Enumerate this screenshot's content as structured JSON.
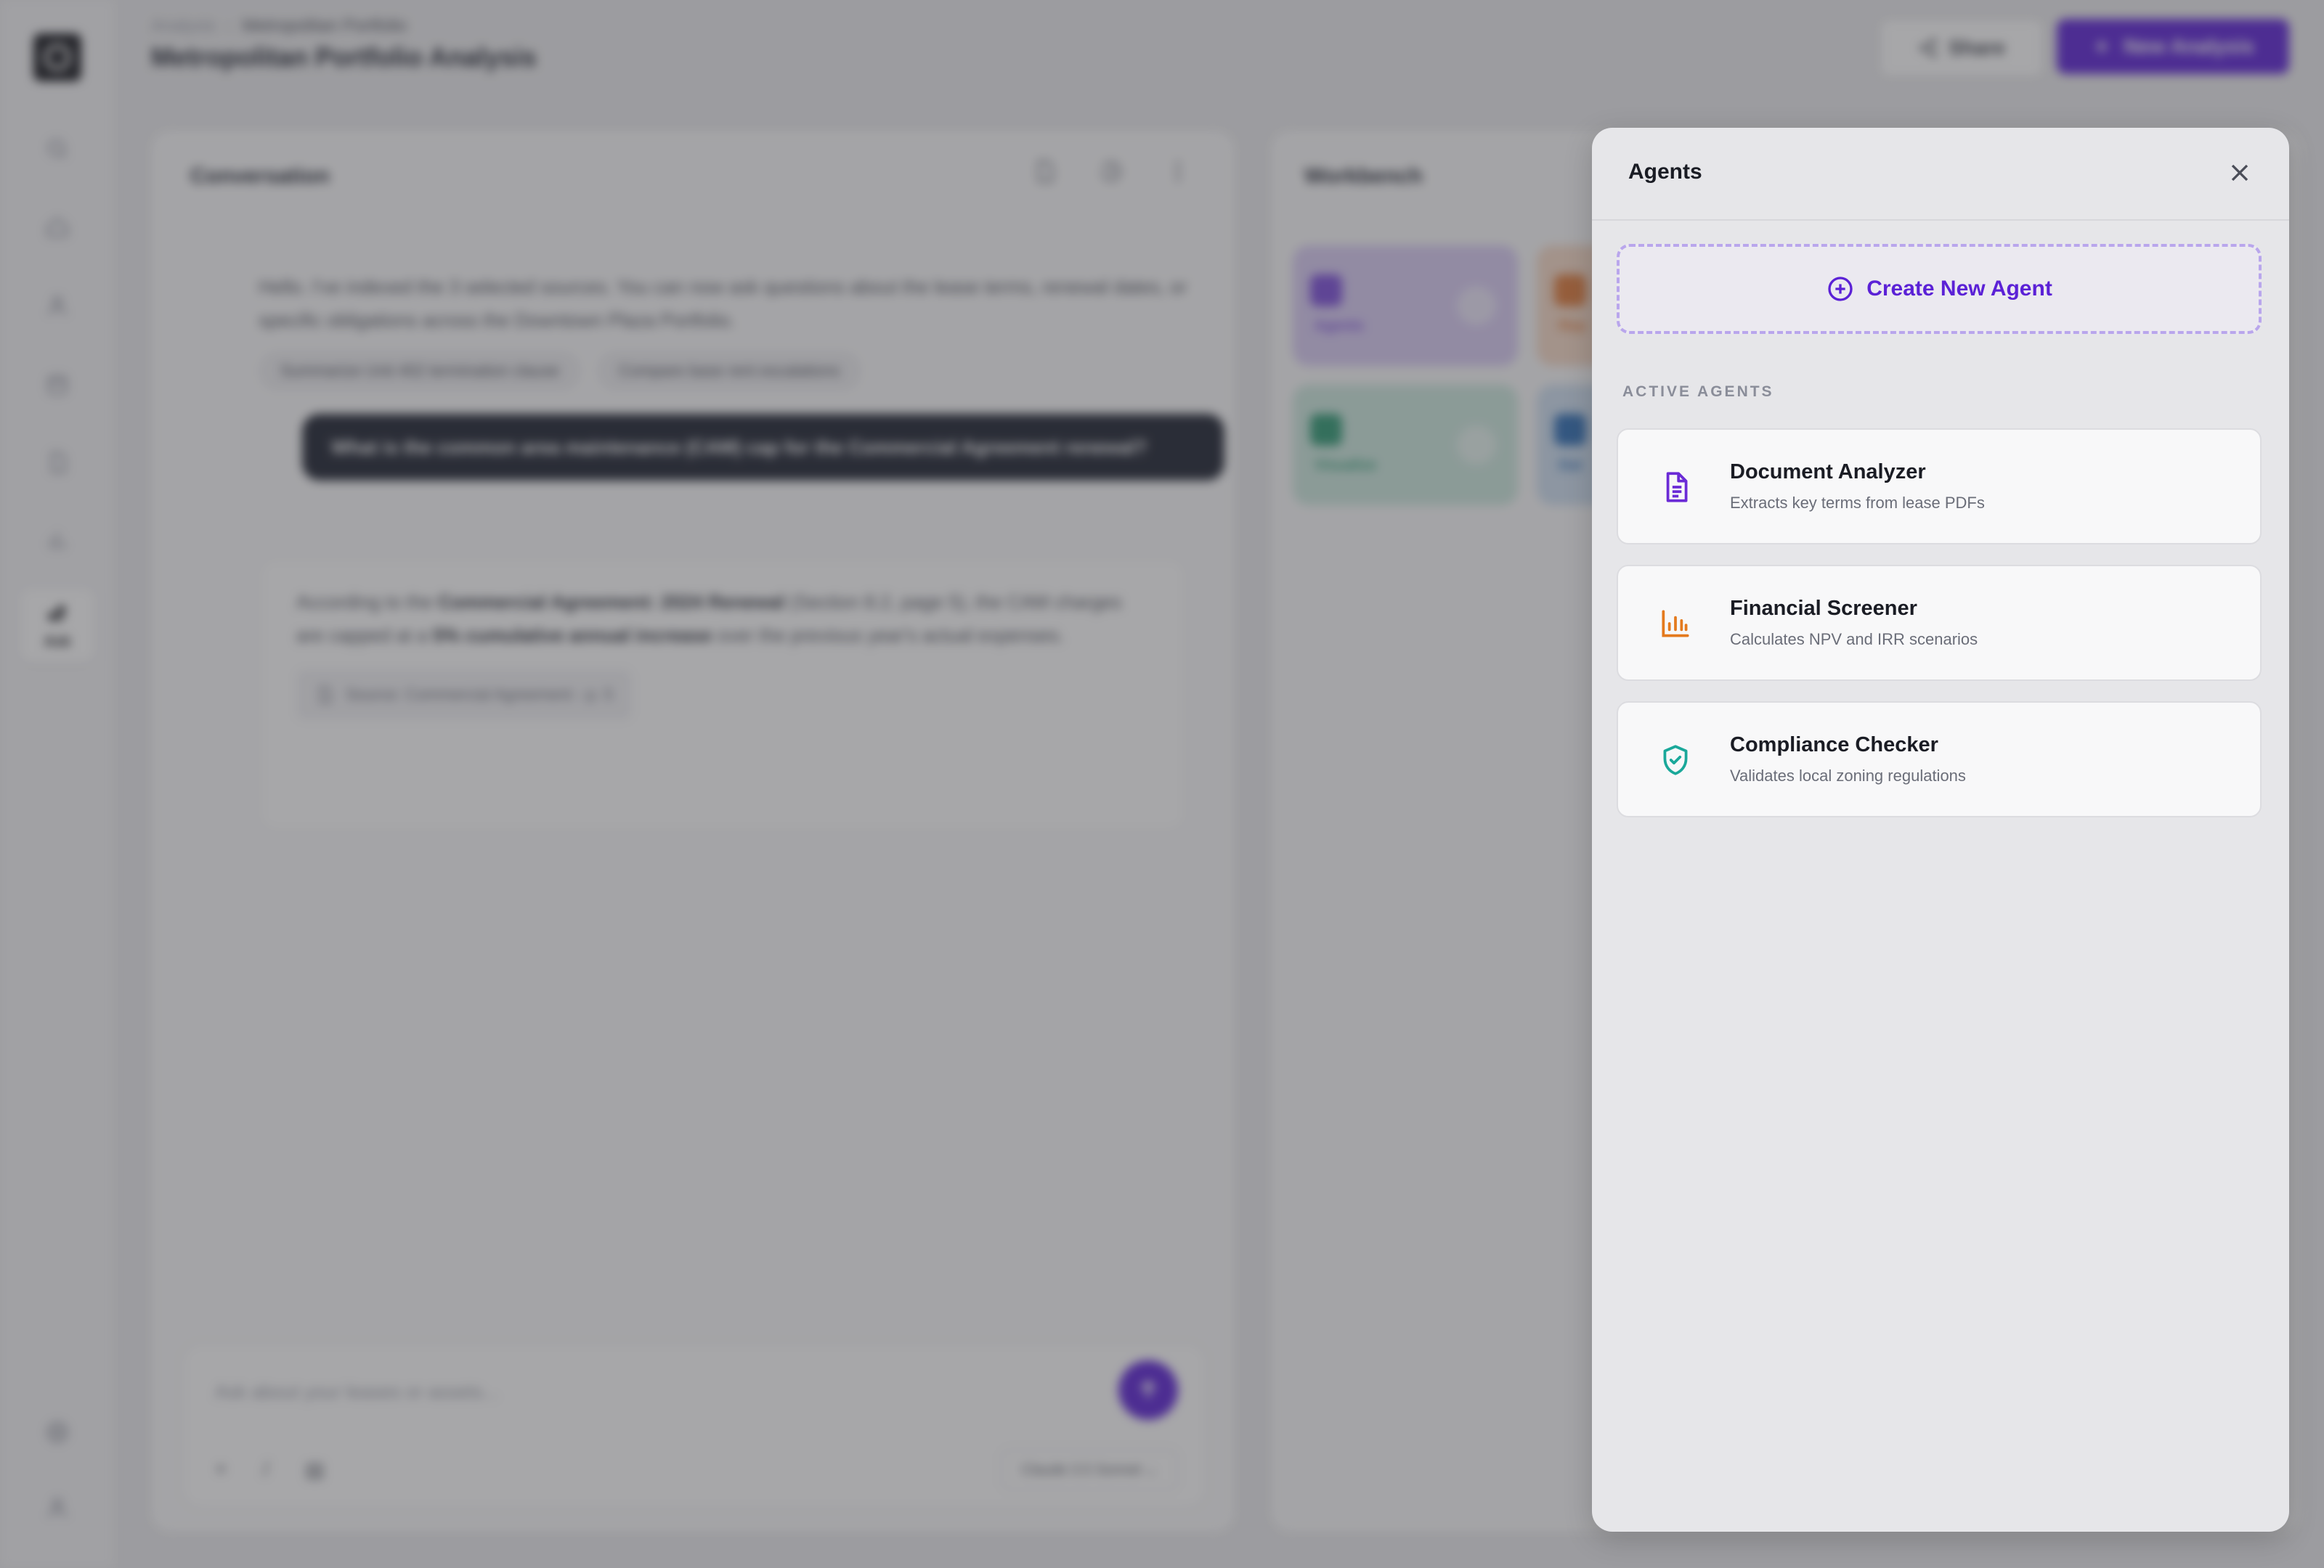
{
  "header": {
    "breadcrumb": [
      "Analysis",
      "Metropolitan Portfolio"
    ],
    "title": "Metropolitan Portfolio Analysis",
    "share_label": "Share",
    "new_analysis_label": "New Analysis"
  },
  "sidebar": {
    "ask_label": "Ask"
  },
  "conversation": {
    "title": "Conversation",
    "ai_greeting": "Hello. I've indexed the 3 selected sources. You can now ask questions about the lease terms, renewal dates, or specific obligations across the Downtown Plaza Portfolio.",
    "suggestions": [
      "Summarize Unit 402 termination clause",
      "Compare base rent escalations"
    ],
    "user_message": "What is the common area maintenance (CAM) cap for the Commercial Agreement renewal?",
    "ai_answer": {
      "t1": "According to the ",
      "b1": "Commercial Agreement: 2024 Renewal",
      "t2": " (Section 8.2, page 5), the CAM charges are capped at a ",
      "b2": "5% cumulative annual increase",
      "t3": " over the previous year's actual expenses."
    },
    "source_label": "Source: Commercial Agreement - p. 5",
    "input_placeholder": "Ask about your leases or assets...",
    "model_label": "Claude 3.5 Sonnet"
  },
  "workbench": {
    "title": "Workbench",
    "tiles": [
      {
        "label": "Agents",
        "color": "#d9ccf5",
        "accent": "#7c4ddb"
      },
      {
        "label": "Rep",
        "color": "#f7dac7",
        "accent": "#e07b3a"
      },
      {
        "label": "Visualize",
        "color": "#cde9df",
        "accent": "#2f9a74"
      },
      {
        "label": "Dat",
        "color": "#cfe0f2",
        "accent": "#2f6fb7"
      }
    ]
  },
  "agents_panel": {
    "title": "Agents",
    "create_label": "Create New Agent",
    "section_label": "ACTIVE AGENTS",
    "agents": [
      {
        "name": "Document Analyzer",
        "desc": "Extracts key terms from lease PDFs",
        "icon": "document-icon",
        "color": "#6b2bd6"
      },
      {
        "name": "Financial Screener",
        "desc": "Calculates NPV and IRR scenarios",
        "icon": "bar-chart-icon",
        "color": "#e47a1e"
      },
      {
        "name": "Compliance Checker",
        "desc": "Validates local zoning regulations",
        "icon": "shield-check-icon",
        "color": "#1aa89a"
      }
    ]
  },
  "colors": {
    "accent": "#5b21d6",
    "dark_bubble": "#1d2230"
  }
}
